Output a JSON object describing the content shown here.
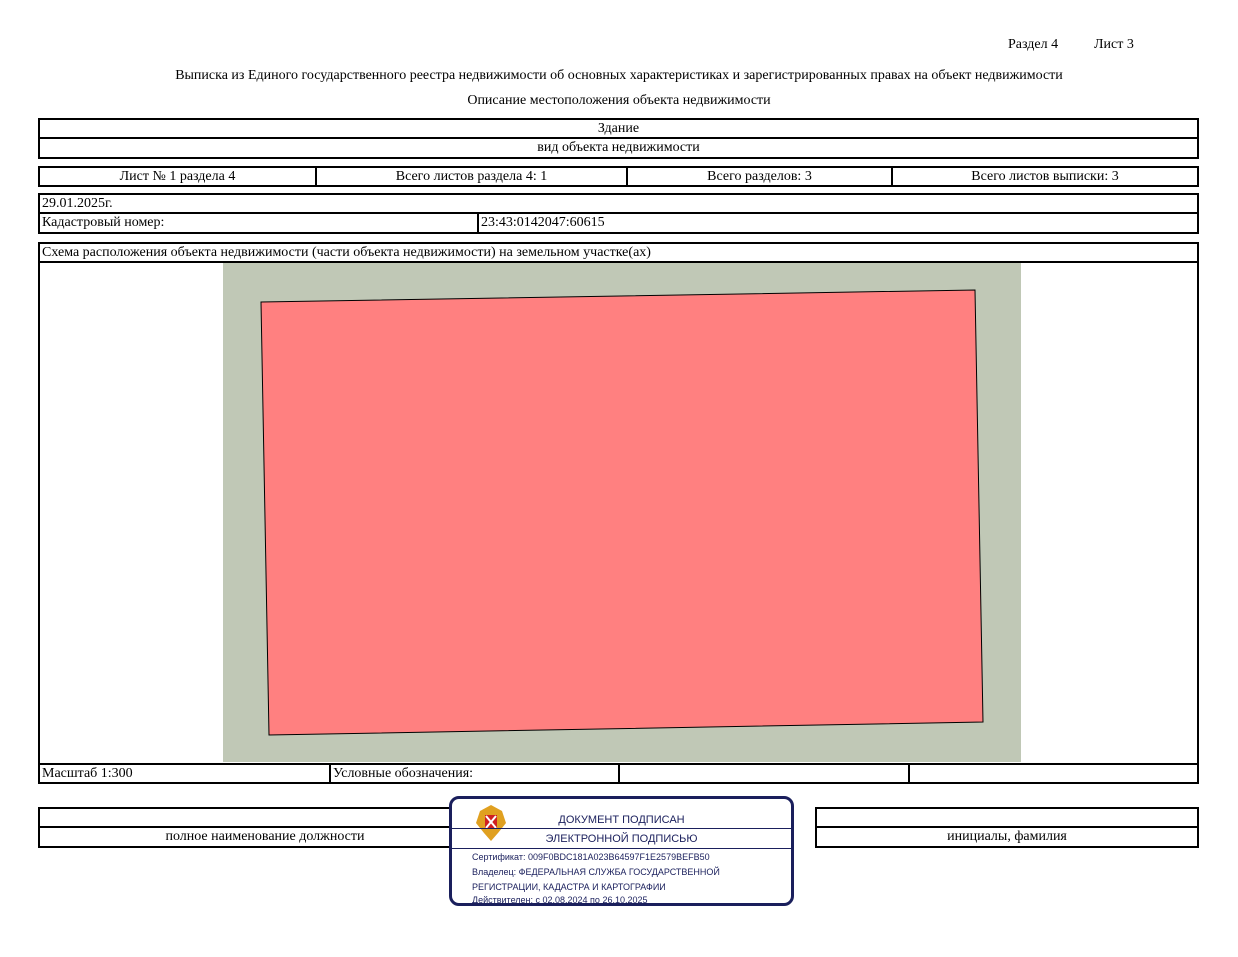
{
  "header": {
    "section": "Раздел 4",
    "sheet": "Лист 3",
    "title": "Выписка из Единого государственного реестра недвижимости об основных характеристиках и зарегистрированных правах на объект недвижимости",
    "subtitle": "Описание местоположения объекта недвижимости"
  },
  "object": {
    "type": "Здание",
    "type_caption": "вид объекта недвижимости"
  },
  "sheets": {
    "sheet_no": "Лист № 1 раздела 4",
    "section_sheets": "Всего листов раздела 4: 1",
    "sections": "Всего разделов: 3",
    "total_sheets": "Всего листов выписки: 3"
  },
  "date": "29.01.2025г.",
  "cadastral": {
    "label": "Кадастровый номер:",
    "value": "23:43:0142047:60615"
  },
  "scheme": {
    "title": "Схема расположения объекта недвижимости (части объекта недвижимости) на земельном участке(ах)",
    "colors": {
      "land": "#c0c8b6",
      "building": "#ff8080"
    }
  },
  "footer": {
    "scale": "Масштаб 1:300",
    "legend": "Условные обозначения:"
  },
  "signature": {
    "position_caption": "полное наименование должности",
    "name_caption": "инициалы, фамилия"
  },
  "stamp": {
    "line1": "ДОКУМЕНТ ПОДПИСАН",
    "line2": "ЭЛЕКТРОННОЙ ПОДПИСЬЮ",
    "cert": "Сертификат: 009F0BDC181A023B64597F1E2579BEFB50",
    "owner1": "Владелец: ФЕДЕРАЛЬНАЯ СЛУЖБА ГОСУДАРСТВЕННОЙ",
    "owner2": "РЕГИСТРАЦИИ, КАДАСТРА И КАРТОГРАФИИ",
    "valid": "Действителен: с 02.08.2024 по 26.10.2025"
  }
}
